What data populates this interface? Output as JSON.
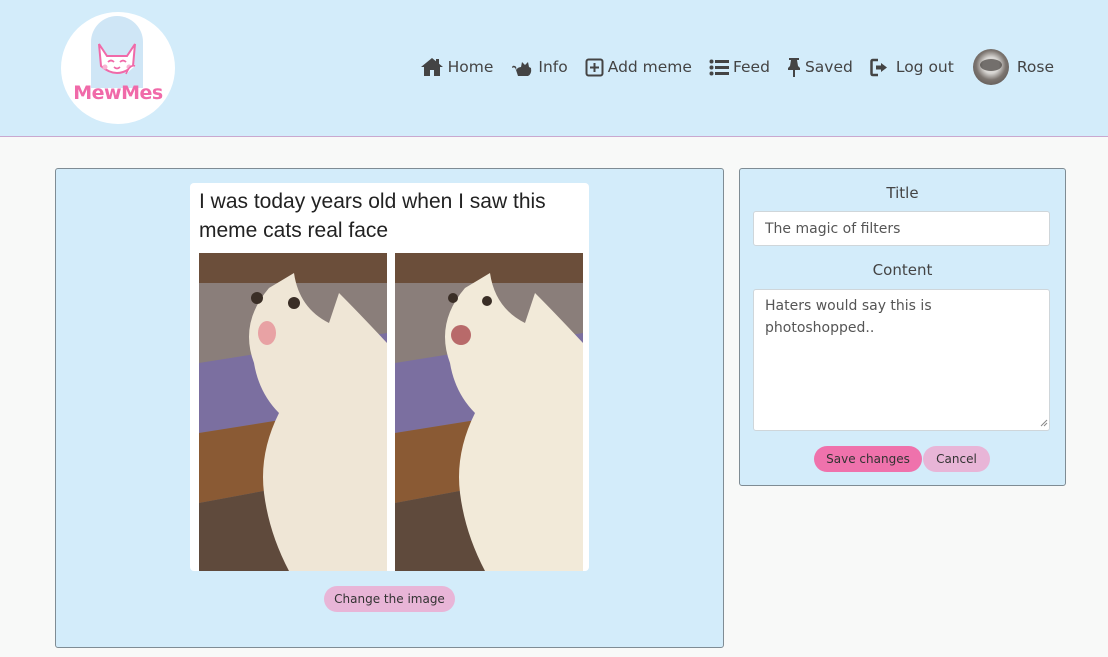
{
  "brand": {
    "name": "MewMes"
  },
  "nav": {
    "home": "Home",
    "info": "Info",
    "add_meme": "Add meme",
    "feed": "Feed",
    "saved": "Saved",
    "logout": "Log out",
    "username": "Rose"
  },
  "meme": {
    "caption": "I was today years old when I saw this meme cats real face",
    "change_image_label": "Change the image"
  },
  "form": {
    "title_label": "Title",
    "title_value": "The magic of filters",
    "content_label": "Content",
    "content_value": "Haters would say this is photoshopped..",
    "save_label": "Save changes",
    "cancel_label": "Cancel"
  },
  "colors": {
    "navbar_bg": "#d3ecfa",
    "card_bg": "#d3ecfa",
    "brand_pink": "#f06aa9",
    "save_button": "#ef72ac",
    "secondary_button": "#e8b5d7"
  },
  "icons": [
    "house-icon",
    "cat-icon",
    "plus-square-icon",
    "list-icon",
    "thumbtack-icon",
    "sign-out-icon"
  ]
}
